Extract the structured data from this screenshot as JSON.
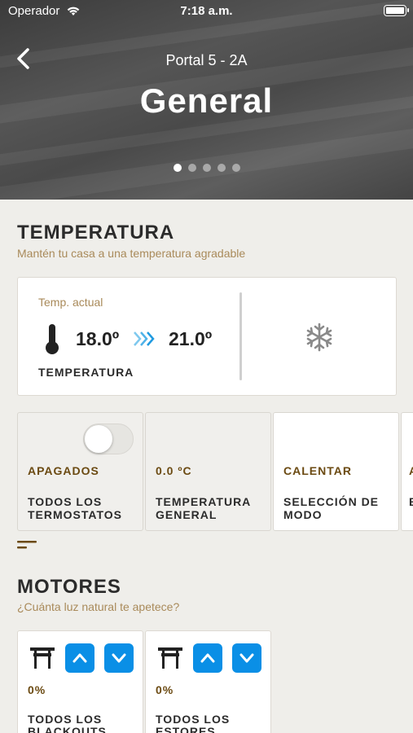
{
  "status_bar": {
    "carrier": "Operador",
    "time": "7:18 a.m."
  },
  "header": {
    "subtitle": "Portal 5 - 2A",
    "title": "General",
    "pager": {
      "count": 5,
      "active": 0
    }
  },
  "temperature_section": {
    "title": "TEMPERATURA",
    "subtitle": "Mantén tu casa a una temperatura agradable",
    "card": {
      "label": "Temp. actual",
      "current": "18.0º",
      "target": "21.0º",
      "name": "TEMPERATURA",
      "mode_icon": "snowflake-icon"
    },
    "tiles": [
      {
        "value": "APAGADOS",
        "label": "TODOS LOS TERMOSTATOS",
        "toggle_on": false
      },
      {
        "value": "0.0 ºC",
        "label": "TEMPERATURA GENERAL"
      },
      {
        "value": "CALENTAR",
        "label": "SELECCIÓN DE MODO"
      },
      {
        "value": "A",
        "label": "E"
      }
    ]
  },
  "motors_section": {
    "title": "MOTORES",
    "subtitle": "¿Cuánta luz natural te apetece?",
    "cards": [
      {
        "percent": "0%",
        "label": "TODOS LOS BLACKOUTS"
      },
      {
        "percent": "0%",
        "label": "TODOS LOS ESTORES"
      }
    ]
  },
  "colors": {
    "accent_blue": "#0a8fe6",
    "value_brown": "#6b4a12",
    "subtitle_gold": "#a98a5a"
  }
}
